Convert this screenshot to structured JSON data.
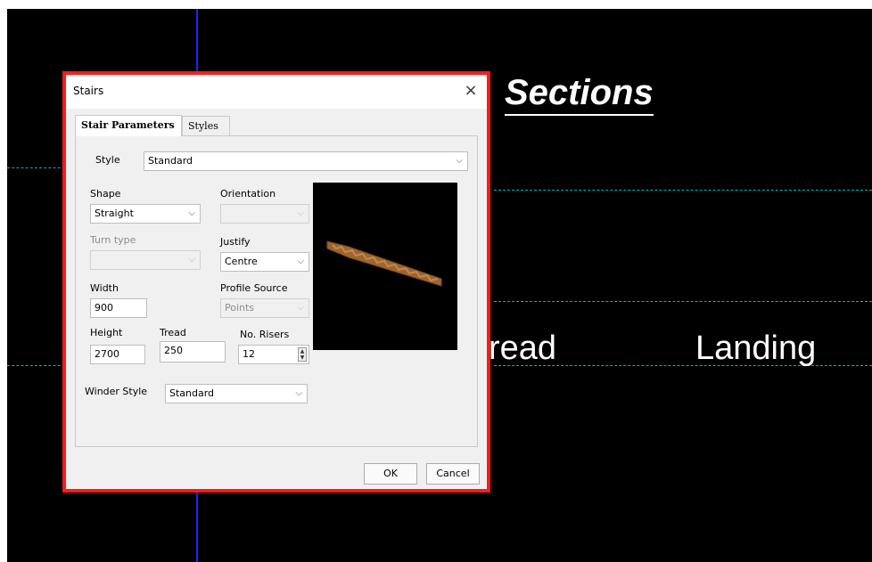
{
  "canvas": {
    "heading": "Sections",
    "label_tread": "read",
    "label_landing": "Landing"
  },
  "dialog": {
    "title": "Stairs",
    "close_glyph": "×",
    "tabs": [
      {
        "label": "Stair Parameters",
        "active": true
      },
      {
        "label": "Styles",
        "active": false
      }
    ],
    "style": {
      "label": "Style",
      "value": "Standard"
    },
    "shape": {
      "label": "Shape",
      "value": "Straight"
    },
    "orientation": {
      "label": "Orientation",
      "value": ""
    },
    "turn_type": {
      "label": "Turn type",
      "value": ""
    },
    "justify": {
      "label": "Justify",
      "value": "Centre"
    },
    "width": {
      "label": "Width",
      "value": "900"
    },
    "profile_source": {
      "label": "Profile Source",
      "value": "Points"
    },
    "height": {
      "label": "Height",
      "value": "2700"
    },
    "tread": {
      "label": "Tread",
      "value": "250"
    },
    "no_risers": {
      "label": "No. Risers",
      "value": "12"
    },
    "winder_style": {
      "label": "Winder Style",
      "value": "Standard"
    },
    "ok_label": "OK",
    "cancel_label": "Cancel"
  },
  "icons": {
    "chevron": "chevron-down-icon",
    "spin_up": "▲",
    "spin_down": "▼"
  },
  "colors": {
    "dialog_border": "#ff1a1a",
    "cad_background": "#000000",
    "axis_line": "#1a25ff",
    "guide_line": "#00b7c3",
    "stair_model": "#a0652e"
  }
}
